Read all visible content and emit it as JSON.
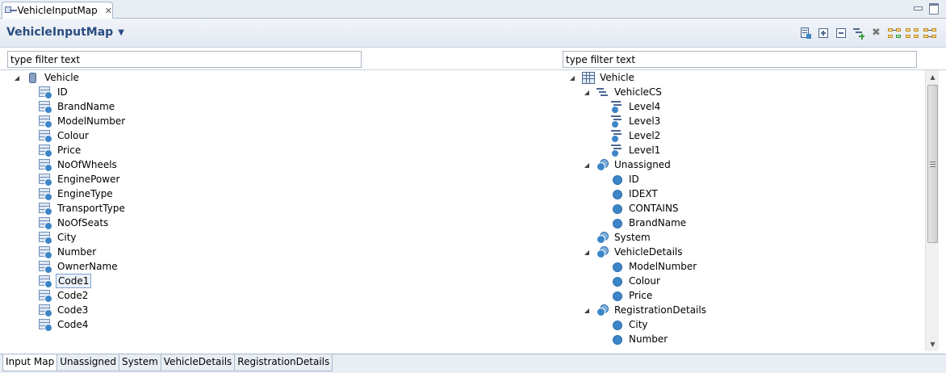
{
  "editor": {
    "tab_title": "VehicleInputMap",
    "close_glyph": "✕",
    "tab_icon": "mapping-icon",
    "window_buttons": [
      "minimize-icon",
      "maximize-icon"
    ]
  },
  "header": {
    "title": "VehicleInputMap",
    "caret": "▼",
    "toolbar_icons": [
      "properties-icon",
      "expand-all-icon",
      "collapse-all-icon",
      "add-mapping-icon",
      "delete-icon",
      "layout-horizontal-icon",
      "layout-grid-icon",
      "layout-tree-icon"
    ]
  },
  "left_filter": {
    "value": "type filter text"
  },
  "right_filter": {
    "value": "type filter text"
  },
  "left_tree": {
    "root": {
      "label": "Vehicle",
      "expander": "◢",
      "icon": "database-icon"
    },
    "items": [
      "ID",
      "BrandName",
      "ModelNumber",
      "Colour",
      "Price",
      "NoOfWheels",
      "EnginePower",
      "EngineType",
      "TransportType",
      "NoOfSeats",
      "City",
      "Number",
      "OwnerName",
      "Code1",
      "Code2",
      "Code3",
      "Code4"
    ],
    "selected": "Code1",
    "item_icon": "attribute-icon"
  },
  "right_tree": {
    "root": {
      "label": "Vehicle",
      "expander": "◢",
      "icon": "table-icon"
    },
    "nodes": [
      {
        "label": "VehicleCS",
        "level": 1,
        "expander": "◢",
        "icon": "hierarchy-icon"
      },
      {
        "label": "Level4",
        "level": 2,
        "expander": "",
        "icon": "level-icon"
      },
      {
        "label": "Level3",
        "level": 2,
        "expander": "",
        "icon": "level-icon"
      },
      {
        "label": "Level2",
        "level": 2,
        "expander": "",
        "icon": "level-icon"
      },
      {
        "label": "Level1",
        "level": 2,
        "expander": "",
        "icon": "level-icon"
      },
      {
        "label": "Unassigned",
        "level": 1,
        "expander": "◢",
        "icon": "group-icon"
      },
      {
        "label": "ID",
        "level": 2,
        "expander": "",
        "icon": "field-icon"
      },
      {
        "label": "IDEXT",
        "level": 2,
        "expander": "",
        "icon": "field-icon"
      },
      {
        "label": "CONTAINS",
        "level": 2,
        "expander": "",
        "icon": "field-icon"
      },
      {
        "label": "BrandName",
        "level": 2,
        "expander": "",
        "icon": "field-icon"
      },
      {
        "label": "System",
        "level": 1,
        "expander": "",
        "icon": "group-icon"
      },
      {
        "label": "VehicleDetails",
        "level": 1,
        "expander": "◢",
        "icon": "group-icon"
      },
      {
        "label": "ModelNumber",
        "level": 2,
        "expander": "",
        "icon": "field-icon"
      },
      {
        "label": "Colour",
        "level": 2,
        "expander": "",
        "icon": "field-icon"
      },
      {
        "label": "Price",
        "level": 2,
        "expander": "",
        "icon": "field-icon"
      },
      {
        "label": "RegistrationDetails",
        "level": 1,
        "expander": "◢",
        "icon": "group-icon"
      },
      {
        "label": "City",
        "level": 2,
        "expander": "",
        "icon": "field-icon"
      },
      {
        "label": "Number",
        "level": 2,
        "expander": "",
        "icon": "field-icon"
      }
    ]
  },
  "scrollbar": {
    "up": "▲",
    "down": "▼"
  },
  "bottom_tabs": {
    "items": [
      "Input Map",
      "Unassigned",
      "System",
      "VehicleDetails",
      "RegistrationDetails"
    ],
    "active": "Input Map"
  }
}
